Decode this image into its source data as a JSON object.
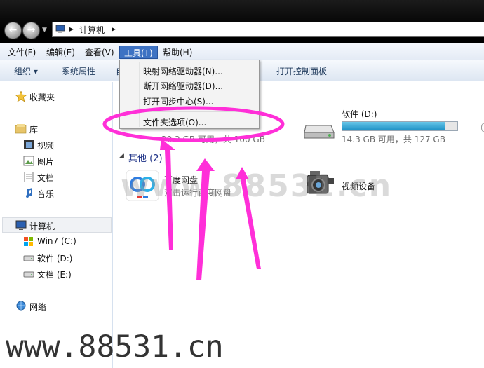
{
  "address": {
    "crumbs": [
      "计算机"
    ]
  },
  "menubar": {
    "items": [
      "文件(F)",
      "编辑(E)",
      "查看(V)",
      "工具(T)",
      "帮助(H)"
    ]
  },
  "cmdbar": {
    "organize": "组织",
    "system_props": "系统属性",
    "hidden_partial": "自",
    "control_panel": "打开控制面板"
  },
  "sidebar": {
    "favorites": "收藏夹",
    "libraries": "库",
    "lib_items": [
      "视频",
      "图片",
      "文档",
      "音乐"
    ],
    "computer": "计算机",
    "drives": [
      "Win7 (C:)",
      "软件 (D:)",
      "文档 (E:)"
    ],
    "network": "网络"
  },
  "content": {
    "drive_d": {
      "name": "软件 (D:)",
      "info": "14.3 GB 可用，共 127 GB",
      "used_fraction": 0.89
    },
    "drive_c_partial": {
      "info": "20.2 GB 可用，共 100 GB"
    },
    "other_header": "其他 (2)",
    "baidu": {
      "name": "百度网盘",
      "sub": "双击运行百度网盘"
    },
    "video_device": {
      "name": "视频设备"
    }
  },
  "dropdown": {
    "items": [
      "映射网络驱动器(N)...",
      "断开网络驱动器(D)...",
      "打开同步中心(S)...",
      "文件夹选项(O)..."
    ]
  },
  "watermarks": {
    "mid": "www.88531.cn",
    "bottom": "www.88531.cn"
  },
  "colors": {
    "highlight": "#ff2fd8",
    "menu_active": "#3d72c3"
  }
}
